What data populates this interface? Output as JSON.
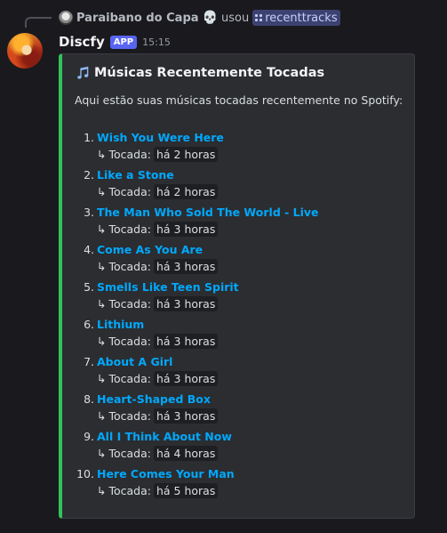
{
  "reply": {
    "user": "Paraibano do Capa",
    "emoji": "💀",
    "verb": "usou",
    "command": "recenttracks"
  },
  "header": {
    "username": "Discfy",
    "badge": "APP",
    "timestamp": "15:15"
  },
  "embed": {
    "accent_color": "#2fc45a",
    "title": "Músicas Recentemente Tocadas",
    "title_icon": "musical-notes-icon",
    "description": "Aqui estão suas músicas tocadas recentemente no Spotify:",
    "played_arrow": "↳",
    "played_label": "Tocada:",
    "tracks": [
      {
        "num": "1.",
        "name": "Wish You Were Here",
        "played": "há 2 horas"
      },
      {
        "num": "2.",
        "name": "Like a Stone",
        "played": "há 2 horas"
      },
      {
        "num": "3.",
        "name": "The Man Who Sold The World - Live",
        "played": "há 3 horas"
      },
      {
        "num": "4.",
        "name": "Come As You Are",
        "played": "há 3 horas"
      },
      {
        "num": "5.",
        "name": "Smells Like Teen Spirit",
        "played": "há 3 horas"
      },
      {
        "num": "6.",
        "name": "Lithium",
        "played": "há 3 horas"
      },
      {
        "num": "7.",
        "name": "About A Girl",
        "played": "há 3 horas"
      },
      {
        "num": "8.",
        "name": "Heart-Shaped Box",
        "played": "há 3 horas"
      },
      {
        "num": "9.",
        "name": "All I Think About Now",
        "played": "há 4 horas"
      },
      {
        "num": "10.",
        "name": "Here Comes Your Man",
        "played": "há 5 horas"
      }
    ]
  }
}
